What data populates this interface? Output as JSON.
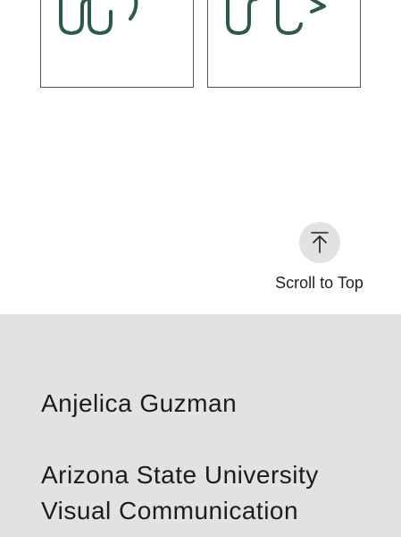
{
  "thumbnails": [
    {
      "icon": "green-squiggle-logo-icon"
    },
    {
      "icon": "green-squiggle-arrow-logo-icon"
    }
  ],
  "scroll_to_top": {
    "icon": "arrow-up-to-line-icon",
    "label": "Scroll to Top"
  },
  "footer": {
    "name": "Anjelica Guzman",
    "school_line1": "Arizona State University",
    "school_line2": "Visual Communication"
  },
  "colors": {
    "logo_green": "#2d5a45",
    "footer_bg": "#e2e2e2",
    "scroll_circle": "#e2e2e2",
    "thumb_border": "#555555"
  }
}
